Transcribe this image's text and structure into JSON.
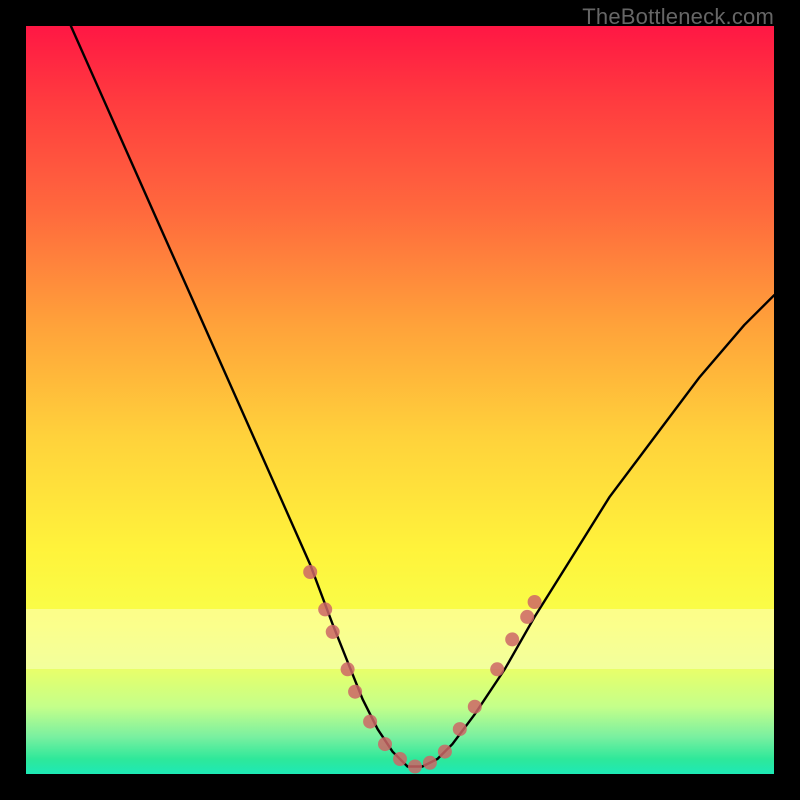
{
  "watermark": "TheBottleneck.com",
  "chart_data": {
    "type": "line",
    "title": "",
    "xlabel": "",
    "ylabel": "",
    "xlim": [
      0,
      100
    ],
    "ylim": [
      0,
      100
    ],
    "series": [
      {
        "name": "curve",
        "x": [
          6,
          10,
          14,
          18,
          22,
          26,
          30,
          34,
          38,
          41,
          43,
          45,
          47,
          49,
          51,
          53,
          55,
          57,
          60,
          64,
          68,
          73,
          78,
          84,
          90,
          96,
          100
        ],
        "y": [
          100,
          91,
          82,
          73,
          64,
          55,
          46,
          37,
          28,
          20,
          15,
          10,
          6,
          3,
          1,
          1,
          2,
          4,
          8,
          14,
          21,
          29,
          37,
          45,
          53,
          60,
          64
        ]
      }
    ],
    "markers": {
      "name": "highlight-dots",
      "color": "#CC6666",
      "points": [
        {
          "x": 38,
          "y": 27
        },
        {
          "x": 40,
          "y": 22
        },
        {
          "x": 41,
          "y": 19
        },
        {
          "x": 43,
          "y": 14
        },
        {
          "x": 44,
          "y": 11
        },
        {
          "x": 46,
          "y": 7
        },
        {
          "x": 48,
          "y": 4
        },
        {
          "x": 50,
          "y": 2
        },
        {
          "x": 52,
          "y": 1
        },
        {
          "x": 54,
          "y": 1.5
        },
        {
          "x": 56,
          "y": 3
        },
        {
          "x": 58,
          "y": 6
        },
        {
          "x": 60,
          "y": 9
        },
        {
          "x": 63,
          "y": 14
        },
        {
          "x": 65,
          "y": 18
        },
        {
          "x": 67,
          "y": 21
        },
        {
          "x": 68,
          "y": 23
        }
      ]
    }
  }
}
